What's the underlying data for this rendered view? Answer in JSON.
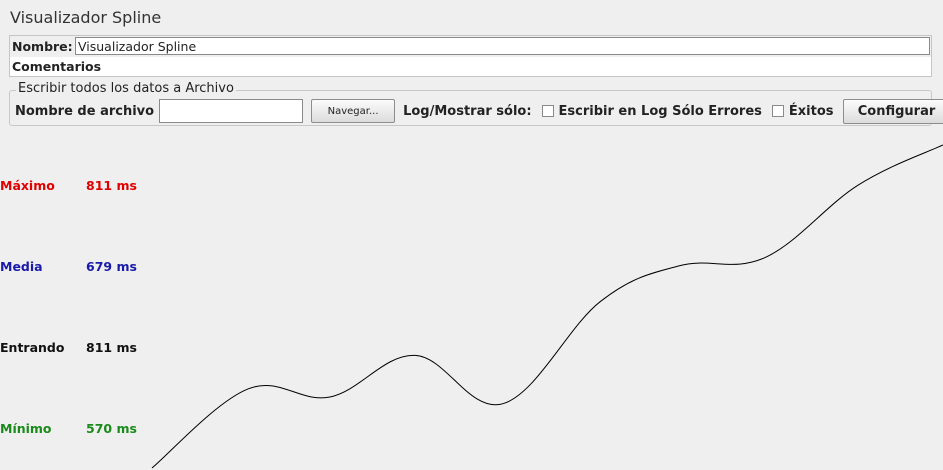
{
  "window": {
    "title": "Visualizador Spline"
  },
  "form": {
    "name_label": "Nombre:",
    "name_value": "Visualizador Spline",
    "comments_label": "Comentarios"
  },
  "file_panel": {
    "legend": "Escribir todos los datos a Archivo",
    "filename_label": "Nombre de archivo",
    "filename_value": "",
    "browse_label": "Navegar...",
    "log_label": "Log/Mostrar sólo:",
    "errors_only_label": "Escribir en Log Sólo Errores",
    "errors_only_checked": false,
    "successes_label": "Éxitos",
    "successes_checked": false,
    "configure_label": "Configurar"
  },
  "stats": {
    "max": {
      "label": "Máximo",
      "value": "811 ms",
      "color": "#e00000"
    },
    "average": {
      "label": "Media",
      "value": "679 ms",
      "color": "#1a1aa8"
    },
    "current": {
      "label": "Entrando",
      "value": "811 ms",
      "color": "#111111"
    },
    "min": {
      "label": "Mínimo",
      "value": "570 ms",
      "color": "#1a8a1a"
    }
  },
  "chart_data": {
    "type": "line",
    "y_unit": "ms",
    "y_range": [
      570,
      811
    ],
    "values": [
      570,
      629,
      623,
      654,
      618,
      694,
      721,
      727,
      781,
      811
    ],
    "color": "#000000"
  }
}
